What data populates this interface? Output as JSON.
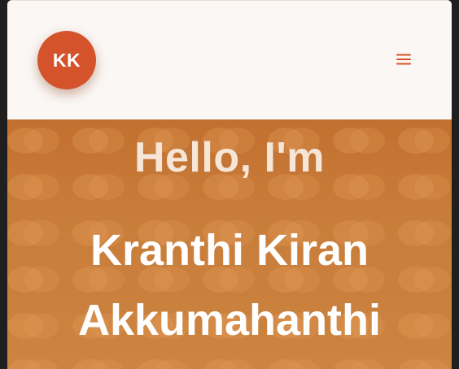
{
  "header": {
    "avatar_initials": "KK",
    "menu_icon": "hamburger-menu-icon",
    "accent_color": "#d4532a"
  },
  "hero": {
    "greeting": "Hello, I'm",
    "name_line1": "Kranthi Kiran",
    "name_line2": "Akkumahanthi",
    "background_color": "#c97d3a"
  }
}
